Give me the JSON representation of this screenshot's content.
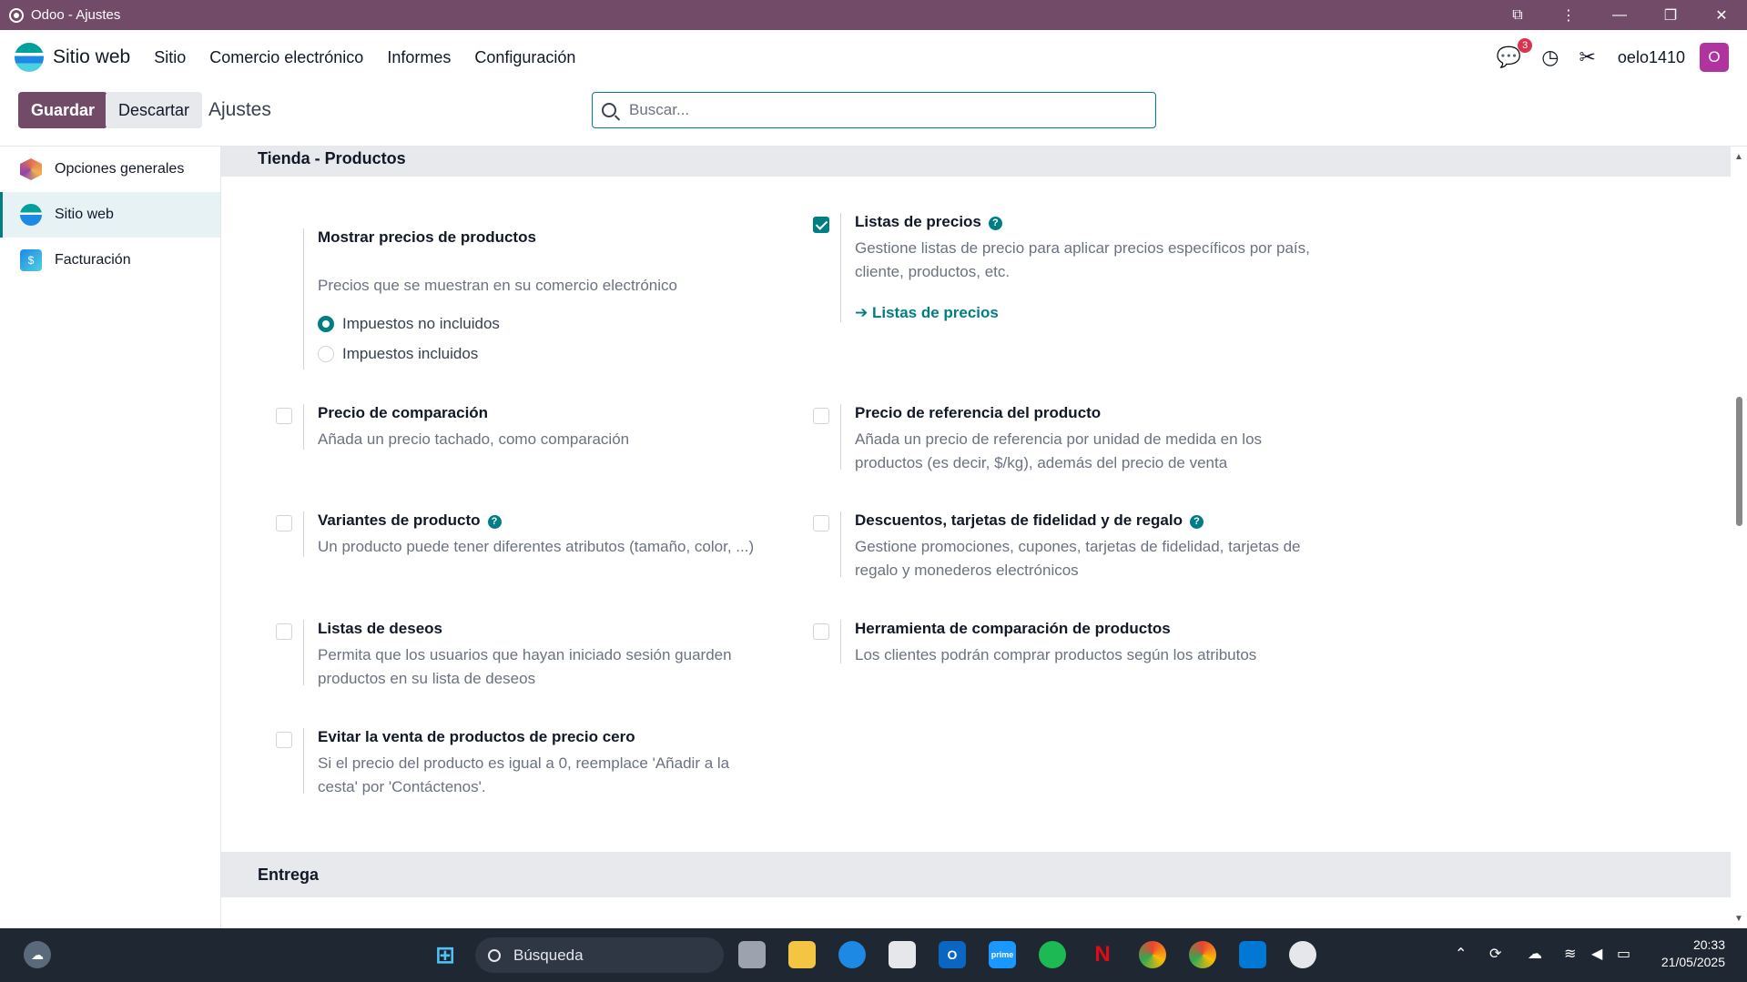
{
  "window": {
    "title": "Odoo - Ajustes"
  },
  "navbar": {
    "brand": "Sitio web",
    "menu": [
      "Sitio",
      "Comercio electrónico",
      "Informes",
      "Configuración"
    ],
    "chat_badge": "3",
    "username": "oelo1410",
    "avatar_letter": "O"
  },
  "control": {
    "save_label": "Guardar",
    "discard_label": "Descartar",
    "breadcrumb": "Ajustes",
    "search_placeholder": "Buscar..."
  },
  "sidebar": {
    "items": [
      {
        "label": "Opciones generales",
        "icon": "odoo-hexagon-icon",
        "color": "#e46f53",
        "active": false
      },
      {
        "label": "Sitio web",
        "icon": "website-app-icon",
        "color": "#00a09d",
        "active": true
      },
      {
        "label": "Facturación",
        "icon": "invoicing-app-icon",
        "color": "#1e88e5",
        "active": false
      }
    ]
  },
  "sections": {
    "products": {
      "title": "Tienda - Productos",
      "show_prices": {
        "title": "Mostrar precios de productos",
        "desc": "Precios que se muestran en su comercio electrónico",
        "options": [
          {
            "label": "Impuestos no incluidos",
            "selected": true
          },
          {
            "label": "Impuestos incluidos",
            "selected": false
          }
        ]
      },
      "pricelists": {
        "title": "Listas de precios",
        "checked": true,
        "desc": "Gestione listas de precio para aplicar precios específicos por país, cliente, productos, etc.",
        "link": "Listas de precios"
      },
      "compare_price": {
        "title": "Precio de comparación",
        "desc": "Añada un precio tachado, como comparación",
        "checked": false
      },
      "ref_price": {
        "title": "Precio de referencia del producto",
        "desc": "Añada un precio de referencia por unidad de medida en los productos (es decir, $/kg), además del precio de venta",
        "checked": false
      },
      "variants": {
        "title": "Variantes de producto",
        "desc": "Un producto puede tener diferentes atributos (tamaño, color, ...)",
        "checked": false
      },
      "loyalty": {
        "title": "Descuentos, tarjetas de fidelidad y de regalo",
        "desc": "Gestione promociones, cupones, tarjetas de fidelidad, tarjetas de regalo y monederos electrónicos",
        "checked": false
      },
      "wishlist": {
        "title": "Listas de deseos",
        "desc": "Permita que los usuarios que hayan iniciado sesión guarden productos en su lista de deseos",
        "checked": false
      },
      "comparison": {
        "title": "Herramienta de comparación de productos",
        "desc": "Los clientes podrán comprar productos según los atributos",
        "checked": false
      },
      "zero_price": {
        "title": "Evitar la venta de productos de precio cero",
        "desc": "Si el precio del producto es igual a 0, reemplace 'Añadir a la cesta' por 'Contáctenos'.",
        "checked": false
      }
    },
    "delivery": {
      "title": "Entrega"
    }
  },
  "taskbar": {
    "search_label": "Búsqueda",
    "time": "20:33",
    "date": "21/05/2025"
  },
  "colors": {
    "brand": "#714b67",
    "accent": "#017e84"
  }
}
